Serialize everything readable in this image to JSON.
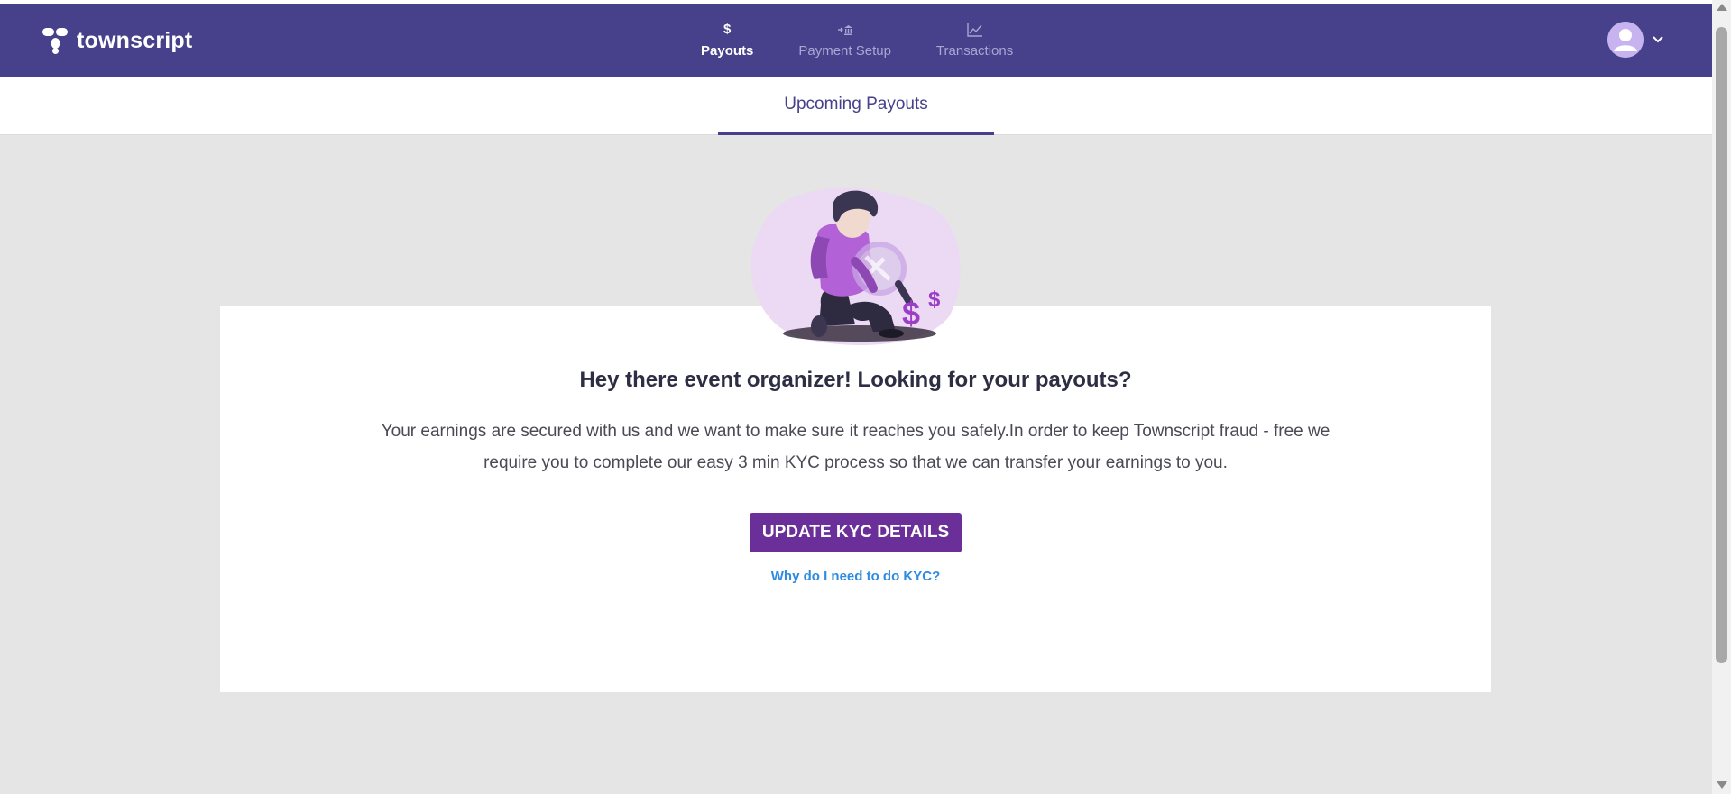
{
  "app": {
    "logo_text": "townscript",
    "brand_color": "#46418a",
    "accent_color": "#6a2f98",
    "link_color": "#2f8be0"
  },
  "nav": {
    "tabs": [
      {
        "label": "Payouts",
        "icon": "dollar-icon",
        "active": true
      },
      {
        "label": "Payment Setup",
        "icon": "bank-transfer-icon",
        "active": false
      },
      {
        "label": "Transactions",
        "icon": "line-chart-icon",
        "active": false
      }
    ]
  },
  "subnav": {
    "tab_label": "Upcoming Payouts"
  },
  "main": {
    "heading": "Hey there event organizer! Looking for your payouts?",
    "description": "Your earnings are secured with us and we want to make sure it reaches you safely.In order to keep Townscript fraud - free we require you to complete our easy 3 min KYC process so that we can transfer your earnings to you.",
    "button_label": "UPDATE KYC DETAILS",
    "link_text": "Why do I need to do KYC?",
    "illustration": "person-with-magnifier-and-dollars-illustration"
  }
}
